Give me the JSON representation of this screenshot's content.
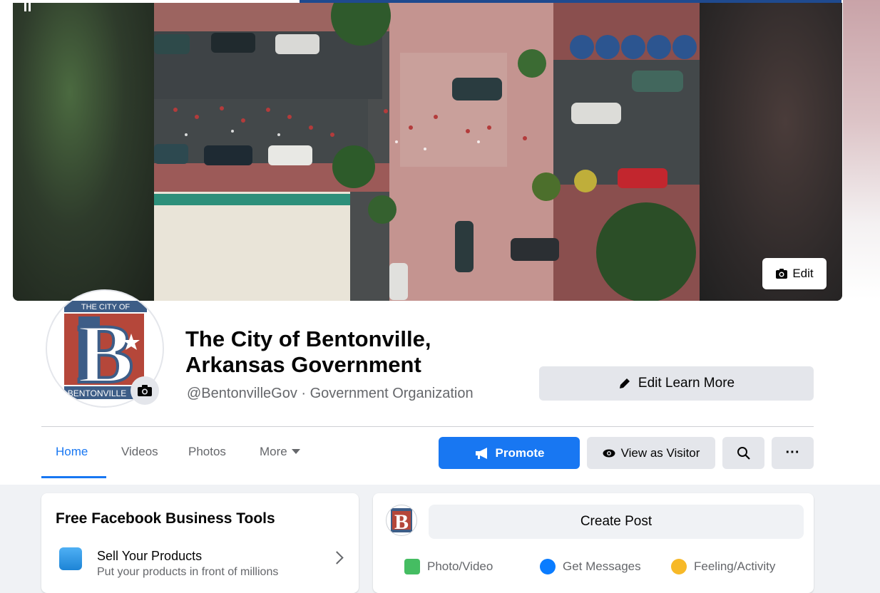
{
  "colors": {
    "accent": "#1877f2",
    "text": "#050505",
    "secondary_text": "#65676b",
    "button_bg": "#e4e6eb"
  },
  "cover": {
    "edit_label": "Edit",
    "edit_icon": "camera-icon"
  },
  "profile": {
    "name": "The City of Bentonville, Arkansas Government",
    "handle": "@BentonvilleGov · Government Organization",
    "logo_top_text": "THE CITY OF",
    "logo_bottom_text": "BENTONVILLE",
    "logo_letter": "B"
  },
  "actions": {
    "edit_learn_more": "Edit Learn More"
  },
  "tabs": [
    {
      "label": "Home",
      "active": true
    },
    {
      "label": "Videos"
    },
    {
      "label": "Photos"
    },
    {
      "label": "More"
    }
  ],
  "toolbar": {
    "promote": "Promote",
    "view_as_visitor": "View as Visitor",
    "more": "···"
  },
  "business_tools": {
    "title": "Free Facebook Business Tools",
    "items": [
      {
        "title": "Sell Your Products",
        "subtitle": "Put your products in front of millions"
      }
    ]
  },
  "composer": {
    "placeholder": "Create Post",
    "actions": [
      {
        "label": "Photo/Video",
        "icon": "photo-icon"
      },
      {
        "label": "Get Messages",
        "icon": "messenger-icon"
      },
      {
        "label": "Feeling/Activity",
        "icon": "smiley-icon"
      }
    ]
  }
}
